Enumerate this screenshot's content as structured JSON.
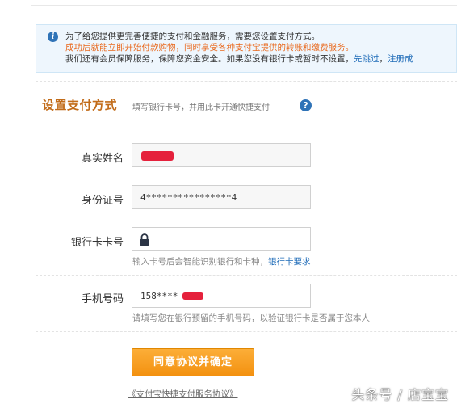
{
  "notice": {
    "line1": "为了给您提供更完善便捷的支付和金融服务，需要您设置支付方式。",
    "line2": "成功后就能立即开始付款购物，同时享受各种支付宝提供的转账和缴费服务。",
    "line3_prefix": "我们还有会员保障服务，保障您资金安全。如果您没有银行卡或暂时不设置，",
    "skip_link": "先跳过",
    "separator": "，",
    "register_link": "注册成"
  },
  "section": {
    "title": "设置支付方式",
    "subtitle": "填写银行卡号，并用此卡开通快捷支付",
    "help": "?"
  },
  "form": {
    "name_label": "真实姓名",
    "id_label": "身份证号",
    "id_value": "4****************4",
    "card_label": "银行卡卡号",
    "card_hint_prefix": "输入卡号后会智能识别银行和卡种，",
    "card_hint_link": "银行卡要求",
    "phone_label": "手机号码",
    "phone_value_prefix": "158****",
    "phone_hint": "请填写您在银行预留的手机号码，以验证银行卡是否属于您本人"
  },
  "submit_label": "同意协议并确定",
  "agreement_link": "《支付宝快捷支付服务协议》",
  "watermark": "头条号 / 店宝宝",
  "colors": {
    "accent_orange": "#f39110",
    "title_orange": "#c26c1a",
    "link_blue": "#1e6bb8",
    "redaction_red": "#e5213c"
  }
}
